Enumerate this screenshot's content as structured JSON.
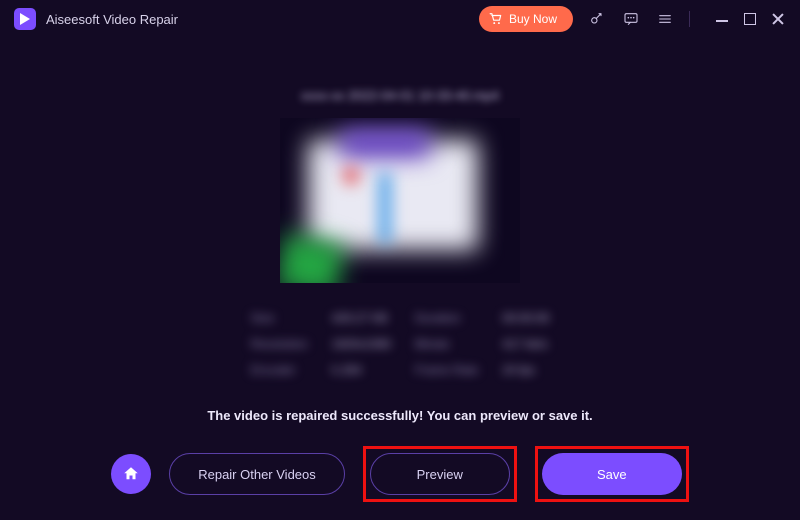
{
  "header": {
    "app_title": "Aiseesoft Video Repair",
    "buy_label": "Buy Now"
  },
  "file": {
    "name_blurred": "xxxx-xx 2022-04-01 10-33-40.mp4"
  },
  "meta": {
    "rows": [
      {
        "k1": "Size",
        "v1": "429.27 KB",
        "k2": "Duration",
        "v2": "00:00:09"
      },
      {
        "k1": "Resolution",
        "v1": "1920x1080",
        "k2": "Bitrate",
        "v2": "417 kb/s"
      },
      {
        "k1": "Encoder",
        "v1": "h.264",
        "k2": "Frame Rate",
        "v2": "24 fps"
      }
    ]
  },
  "status_message": "The video is repaired successfully! You can preview or save it.",
  "actions": {
    "repair_other": "Repair Other Videos",
    "preview": "Preview",
    "save": "Save"
  }
}
